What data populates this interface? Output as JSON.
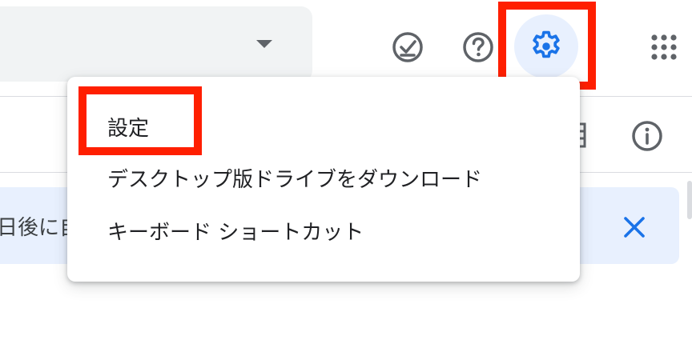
{
  "colors": {
    "accent": "#1a73e8",
    "highlight_box": "#ff1f00",
    "settings_active_bg": "#e8f0fe",
    "banner_bg": "#e8f0fe",
    "icon_gray": "#5f6368"
  },
  "header": {
    "search_dropdown_icon": "caret-down-icon",
    "offline_icon": "offline-ready-icon",
    "help_icon": "help-icon",
    "settings_icon": "gear-icon",
    "apps_icon": "apps-grid-icon"
  },
  "toolbar": {
    "grid_view_icon": "grid-view-icon",
    "info_icon": "info-icon"
  },
  "banner": {
    "text": "日後に自",
    "close_icon": "close-icon"
  },
  "settings_menu": {
    "items": [
      {
        "label": "設定"
      },
      {
        "label": "デスクトップ版ドライブをダウンロード"
      },
      {
        "label": "キーボード ショートカット"
      }
    ]
  }
}
